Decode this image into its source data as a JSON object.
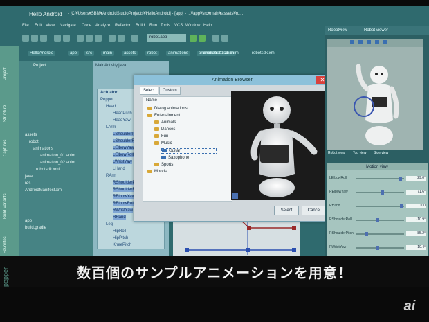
{
  "window": {
    "app_name": "Hello Android",
    "path_text": "- [C:¥Users¥SBM¥AndroidStudioProjects¥HelloAndroid] - [app] - ...¥app¥src¥main¥assets¥ro...",
    "menu": [
      "File",
      "Edit",
      "View",
      "Navigate",
      "Code",
      "Analyze",
      "Refactor",
      "Build",
      "Run",
      "Tools",
      "VCS",
      "Window",
      "Help"
    ],
    "run_config": "robot.app"
  },
  "breadcrumbs": [
    "HelloAndroid",
    "app",
    "src",
    "main",
    "assets",
    "robot",
    "animations",
    "animation_01.anim"
  ],
  "tabs": [
    "MainActivity.java",
    "animation_01.anim",
    "robotsdk.xml"
  ],
  "left_strip": [
    "Project",
    "Structure",
    "Captures",
    "Build Variants",
    "Favorites"
  ],
  "project_tree": [
    "Project",
    "assets",
    "robot",
    "animations",
    "animation_01.anim",
    "animation_02.anim",
    "robotsdk.xml",
    "java",
    "res",
    "AndroidManifest.xml",
    "app",
    "build.gradle"
  ],
  "actuator": {
    "header": "Actuator",
    "items": [
      "Pepper",
      "Head",
      "HeadPitch",
      "HeadYaw",
      "LArm",
      "LShoulderPitch",
      "LShoulderRoll",
      "LElbowYaw",
      "LElbowRoll",
      "LWristYaw",
      "LHand",
      "RArm",
      "RShoulderPitch",
      "RShoulderRoll",
      "RElbowYaw",
      "RElbowRoll",
      "RWristYaw",
      "RHand",
      "Leg",
      "HipRoll",
      "HipPitch",
      "KneePitch"
    ]
  },
  "dialog": {
    "title": "Animation Browser",
    "tabs": [
      "Select",
      "Custom"
    ],
    "tree_header": "Name",
    "tree": [
      "Dialog animations",
      "Entertainment",
      "Animals",
      "Dances",
      "Fun",
      "Music",
      "Guitar",
      "Saxophone",
      "Sports",
      "Moods"
    ],
    "buttons": [
      "Select",
      "Cancel"
    ]
  },
  "robot_viewer": {
    "title": "Robot viewer",
    "subtitle": "Robotview",
    "view_tabs": [
      "Robot view",
      "Top view",
      "Side view"
    ]
  },
  "motion_view": {
    "title": "Motion view",
    "rows": [
      {
        "label": "LElbowRoll",
        "value": "29.0°",
        "level": 0.95
      },
      {
        "label": "RElbowYaw",
        "value": "71.6°",
        "level": 0.55
      },
      {
        "label": "RHand",
        "value": "100",
        "level": 0.98
      },
      {
        "label": "RShoulderRoll",
        "value": "-10.9°",
        "level": 0.45
      },
      {
        "label": "RShoulderPitch",
        "value": "-85.2°",
        "level": 0.2
      },
      {
        "label": "RWristYaw",
        "value": "-10.4°",
        "level": 0.45
      }
    ]
  },
  "caption": "数百個のサンプルアニメーションを用意！",
  "brand": "pepper",
  "logo": "ai",
  "colors": {
    "accent": "#2f6a6e",
    "dialog_title": "#8cc1da",
    "close": "#d9413c"
  }
}
